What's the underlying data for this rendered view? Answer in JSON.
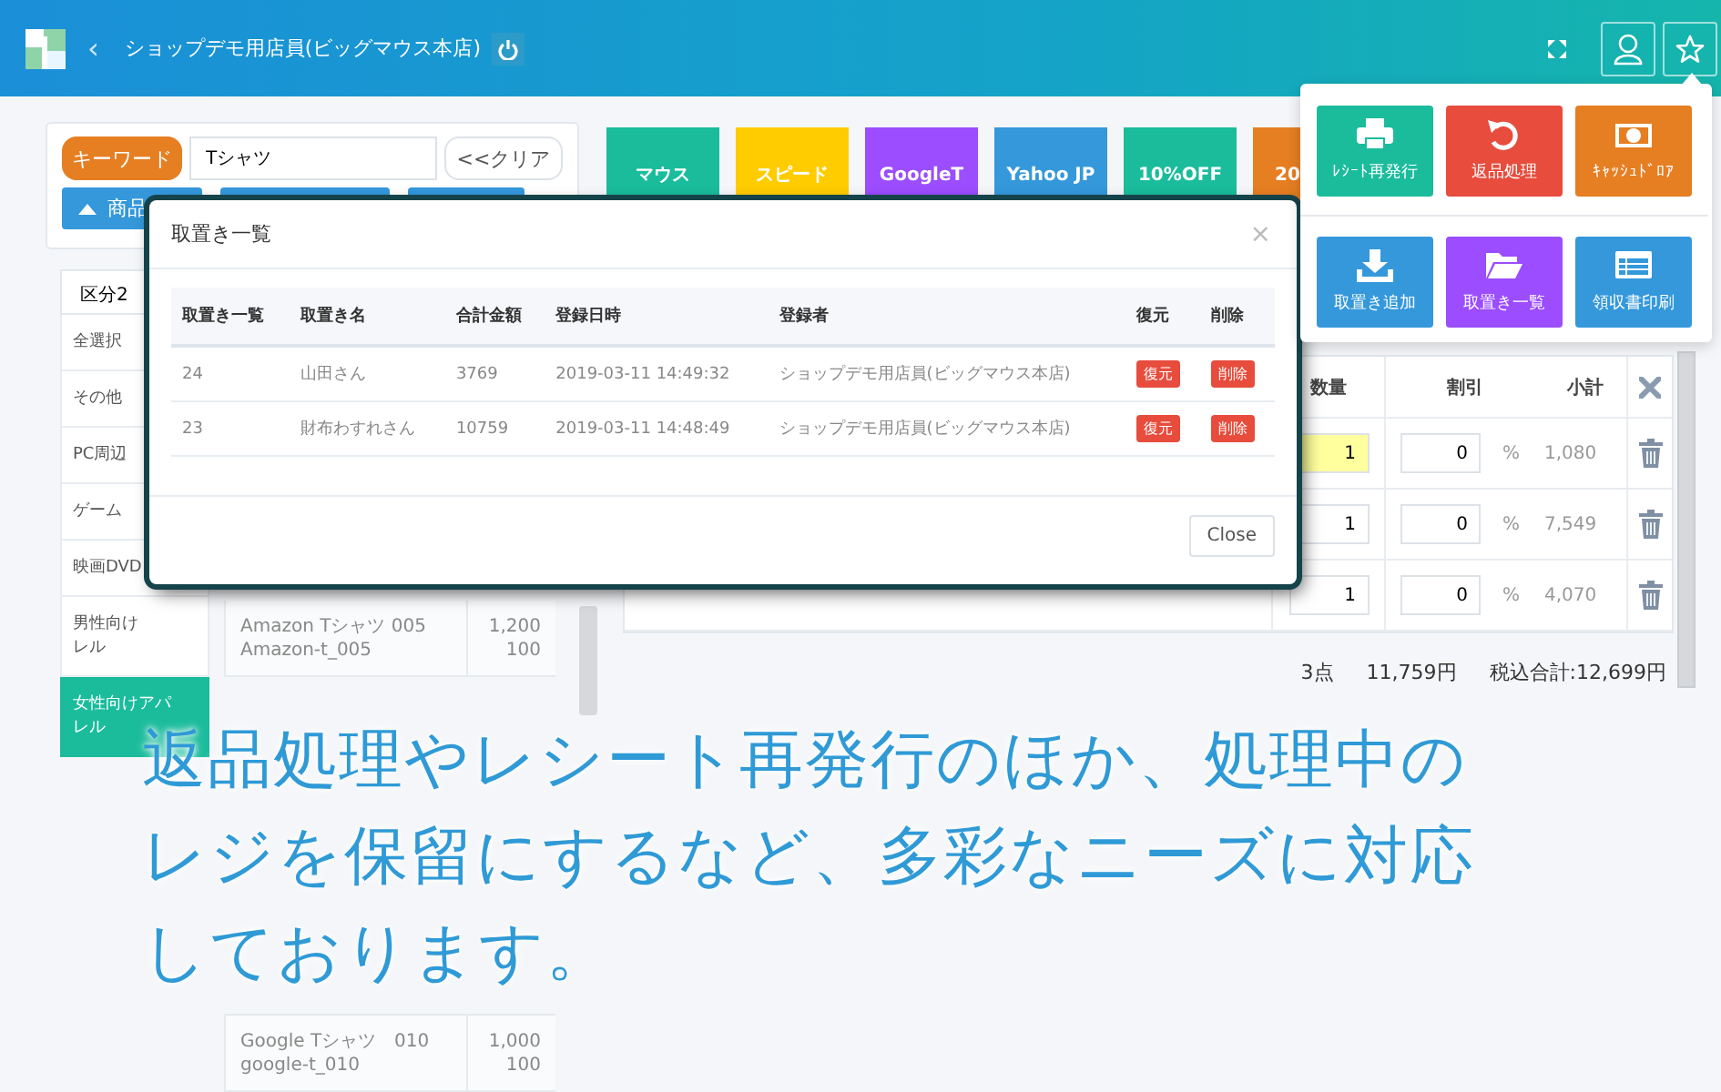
{
  "header": {
    "back": "‹",
    "title": "ショップデモ用店員(ビッグマウス本店)"
  },
  "search": {
    "keyword_button": "キーワード",
    "value": "Tシャツ",
    "clear_button": "<<クリア",
    "sort_button": "商品"
  },
  "categories": {
    "header": "区分2",
    "items": [
      {
        "lines": [
          "全選択"
        ],
        "selected": false
      },
      {
        "lines": [
          "その他"
        ],
        "selected": false
      },
      {
        "lines": [
          "PC周辺"
        ],
        "selected": false
      },
      {
        "lines": [
          "ゲーム"
        ],
        "selected": false
      },
      {
        "lines": [
          "映画DVD"
        ],
        "selected": false
      },
      {
        "lines": [
          "男性向け",
          "レル"
        ],
        "selected": false
      },
      {
        "lines": [
          "女性向けアパ",
          "レル"
        ],
        "selected": true
      }
    ]
  },
  "products": [
    {
      "name": "Amazon Tシャツ 005",
      "code": "Amazon-t_005",
      "price": "1,200",
      "stock": "100"
    },
    {
      "name": "Google Tシャツ　010",
      "code": "google-t_010",
      "price": "1,000",
      "stock": "100"
    }
  ],
  "quick_buttons": [
    {
      "label": "マウス",
      "color": "#1abc9c"
    },
    {
      "label": "スピード",
      "color": "#ffcc00"
    },
    {
      "label": "GoogleT",
      "color": "#9b4dff"
    },
    {
      "label": "Yahoo JP",
      "color": "#3498db"
    },
    {
      "label": "10%OFF",
      "color": "#1abc9c"
    },
    {
      "label": "20",
      "color": "#e67e22"
    }
  ],
  "cart": {
    "columns": [
      "数量",
      "割引",
      "小計"
    ],
    "rows": [
      {
        "qty": "1",
        "focused": true,
        "discount": "0",
        "unit": "%",
        "subtotal": "1,080"
      },
      {
        "qty": "1",
        "focused": false,
        "discount": "0",
        "unit": "%",
        "subtotal": "7,549"
      },
      {
        "qty": "1",
        "focused": false,
        "discount": "0",
        "unit": "%",
        "subtotal": "4,070"
      }
    ],
    "summary": {
      "count": "3点",
      "subtotal": "11,759円",
      "total": "税込合計:12,699円"
    }
  },
  "modal": {
    "title": "取置き一覧",
    "close_x": "×",
    "columns": [
      "取置き一覧",
      "取置き名",
      "合計金額",
      "登録日時",
      "登録者",
      "復元",
      "削除"
    ],
    "rows": [
      {
        "id": "24",
        "name": "山田さん",
        "total": "3769",
        "date": "2019-03-11 14:49:32",
        "user": "ショップデモ用店員(ビッグマウス本店)",
        "restore": "復元",
        "delete": "削除"
      },
      {
        "id": "23",
        "name": "財布わすれさん",
        "total": "10759",
        "date": "2019-03-11 14:48:49",
        "user": "ショップデモ用店員(ビッグマウス本店)",
        "restore": "復元",
        "delete": "削除"
      }
    ],
    "close_button": "Close"
  },
  "menu": {
    "tiles": [
      {
        "kind": "printer",
        "label": "ﾚｼｰﾄ再発行",
        "color": "#1abc9c"
      },
      {
        "kind": "undo",
        "label": "返品処理",
        "color": "#e74c3c"
      },
      {
        "kind": "cash",
        "label": "ｷｬｯｼｭﾄﾞﾛｱ",
        "color": "#e67e22"
      },
      {
        "kind": "download",
        "label": "取置き追加",
        "color": "#3498db"
      },
      {
        "kind": "folder",
        "label": "取置き一覧",
        "color": "#9b4dff"
      },
      {
        "kind": "list",
        "label": "領収書印刷",
        "color": "#3498db"
      }
    ]
  },
  "caption": {
    "lines": [
      "返品処理やレシート再発行のほか、処理中の",
      "レジを保留にするなど、多彩なニーズに対応",
      "しております。"
    ]
  }
}
